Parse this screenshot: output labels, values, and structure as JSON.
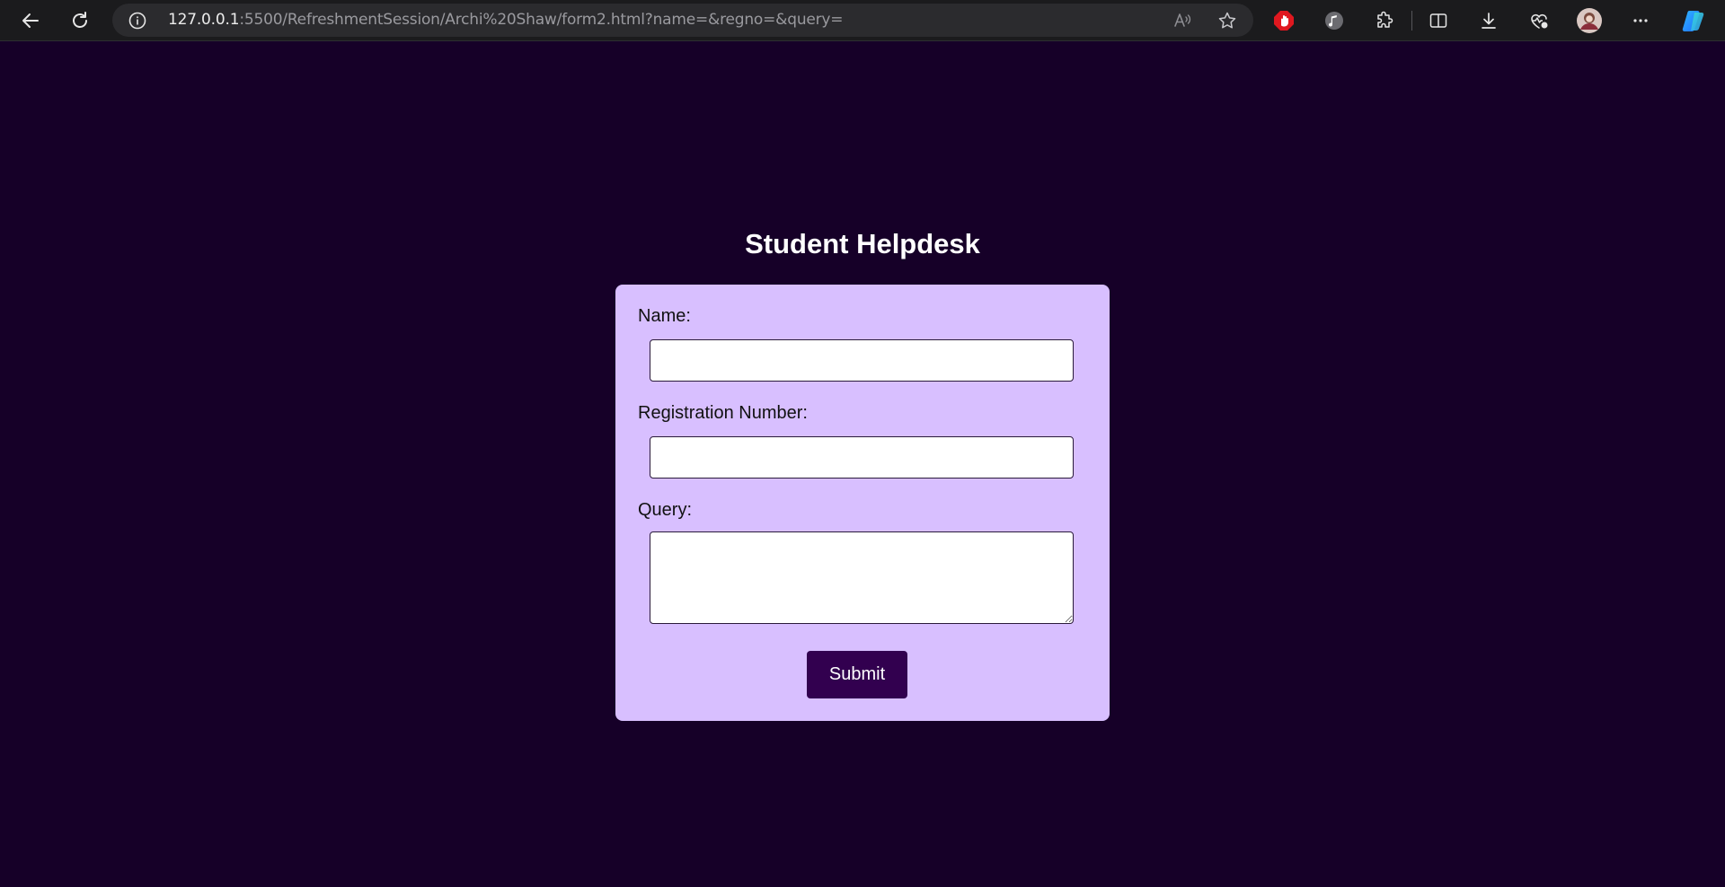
{
  "browser": {
    "url_host": "127.0.0.1",
    "url_rest": ":5500/RefreshmentSession/Archi%20Shaw/form2.html?name=&regno=&query=",
    "icons": [
      "back-icon",
      "refresh-icon",
      "site-info-icon",
      "read-aloud-icon",
      "favorite-star-icon",
      "adblock-extension-icon",
      "music-extension-icon",
      "extensions-icon",
      "split-screen-icon",
      "downloads-icon",
      "browser-essentials-icon",
      "profile-avatar",
      "more-menu-icon",
      "copilot-icon"
    ]
  },
  "page": {
    "title": "Student Helpdesk",
    "form": {
      "name_label": "Name:",
      "name_value": "",
      "regno_label": "Registration Number:",
      "regno_value": "",
      "query_label": "Query:",
      "query_value": "",
      "submit_label": "Submit"
    }
  },
  "colors": {
    "page_background": "#160028",
    "card_background": "#d8bfff",
    "button_background": "#32004f",
    "title_text": "#ffffff"
  }
}
